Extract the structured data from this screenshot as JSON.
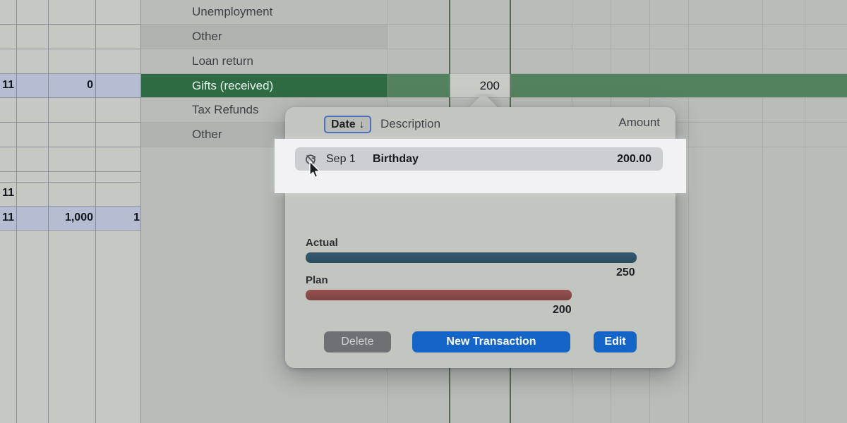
{
  "spreadsheet": {
    "categories": [
      {
        "label": "Unemployment",
        "shade": "normal"
      },
      {
        "label": "Other",
        "shade": "alt"
      },
      {
        "label": "Loan return",
        "shade": "normal"
      },
      {
        "label": "Gifts (received)",
        "shade": "selected"
      },
      {
        "label": "Tax Refunds",
        "shade": "normal"
      },
      {
        "label": "Other",
        "shade": "alt"
      }
    ],
    "selected_cell_value": "200",
    "left_pane_values": [
      {
        "row_label": "11",
        "value": "0"
      },
      {
        "row_label": "11",
        "value": ""
      },
      {
        "row_label": "11",
        "value": "1,000"
      },
      {
        "row_label": "",
        "value": "1"
      }
    ],
    "colors": {
      "selected_row_green": "#2f6b42",
      "selected_band_green": "#54825f",
      "grid_line": "#7d8694",
      "selection_blue": "#b6bdd2"
    }
  },
  "popover": {
    "header": {
      "sort_column_label": "Date",
      "sort_direction_icon": "↓",
      "description_label": "Description",
      "amount_label": "Amount"
    },
    "transactions": [
      {
        "recurring_icon": "recurring-off-icon",
        "date": "Sep 1",
        "description": "Birthday",
        "amount": "200.00"
      }
    ],
    "bars": {
      "actual": {
        "label": "Actual",
        "value": "250",
        "color": "#2f5266"
      },
      "plan": {
        "label": "Plan",
        "value": "200",
        "color": "#80443f"
      }
    },
    "buttons": {
      "delete": "Delete",
      "new_transaction": "New Transaction",
      "edit": "Edit"
    }
  },
  "chart_data": {
    "type": "bar",
    "orientation": "horizontal",
    "categories": [
      "Actual",
      "Plan"
    ],
    "values": [
      250,
      200
    ],
    "title": "",
    "xlabel": "",
    "ylabel": "",
    "xlim": [
      0,
      250
    ],
    "grid": false,
    "legend": "none",
    "colors": [
      "#2f5266",
      "#80443f"
    ],
    "data_labels": [
      "250",
      "200"
    ]
  }
}
